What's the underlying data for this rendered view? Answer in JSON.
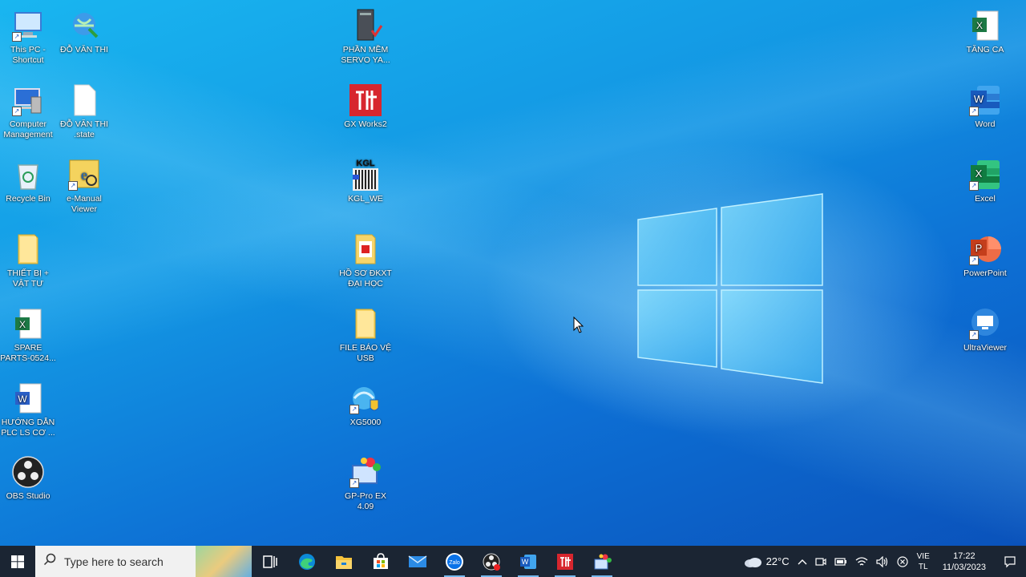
{
  "desktop": {
    "icons": [
      {
        "label": "This PC - Shortcut",
        "icon": "computer-icon"
      },
      {
        "label": "ĐỖ VĂN THI",
        "icon": "user-globe-icon"
      },
      {
        "label": "PHẦN MỀM SERVO YA...",
        "icon": "server-icon"
      },
      {
        "label": "TĂNG CA",
        "icon": "excel-icon"
      },
      {
        "label": "Computer Management",
        "icon": "computer-management-icon"
      },
      {
        "label": "ĐỖ VĂN THI .state",
        "icon": "blank-file-icon"
      },
      {
        "label": "GX Works2",
        "icon": "gx-works-icon"
      },
      {
        "label": "Word",
        "icon": "word-icon"
      },
      {
        "label": "Recycle Bin",
        "icon": "recycle-bin-icon"
      },
      {
        "label": "e-Manual Viewer",
        "icon": "emanual-icon"
      },
      {
        "label": "KGL_WE",
        "icon": "kgl-icon"
      },
      {
        "label": "Excel",
        "icon": "excel-icon"
      },
      {
        "label": "THIẾT BỊ + VẬT TƯ",
        "icon": "folder-icon"
      },
      {
        "label": "HỒ SƠ ĐKXT ĐẠI HỌC",
        "icon": "folder-pdf-icon"
      },
      {
        "label": "PowerPoint",
        "icon": "powerpoint-icon"
      },
      {
        "label": "SPARE PARTS-0524...",
        "icon": "excel-file-icon"
      },
      {
        "label": "FILE BÁO VỆ USB",
        "icon": "folder-icon"
      },
      {
        "label": "UltraViewer",
        "icon": "ultraviewer-icon"
      },
      {
        "label": "HƯỚNG DẪN PLC LS CƠ ...",
        "icon": "word-file-icon"
      },
      {
        "label": "XG5000",
        "icon": "xg5000-icon"
      },
      {
        "label": "OBS Studio",
        "icon": "obs-icon"
      },
      {
        "label": "GP-Pro EX 4.09",
        "icon": "gp-pro-icon"
      }
    ]
  },
  "taskbar": {
    "search_placeholder": "Type here to search",
    "apps": [
      "task-view-icon",
      "edge-icon",
      "file-explorer-icon",
      "store-icon",
      "mail-icon",
      "zalo-icon",
      "obs-icon",
      "word-icon",
      "gx-works-icon",
      "gp-pro-icon"
    ],
    "zalo_label": "Zalo",
    "weather": "22°C",
    "language_top": "VIE",
    "language_bottom": "TL",
    "time": "17:22",
    "date": "11/03/2023"
  },
  "colors": {
    "taskbar": "#1b2533",
    "desktop_accent": "#1398e4"
  }
}
